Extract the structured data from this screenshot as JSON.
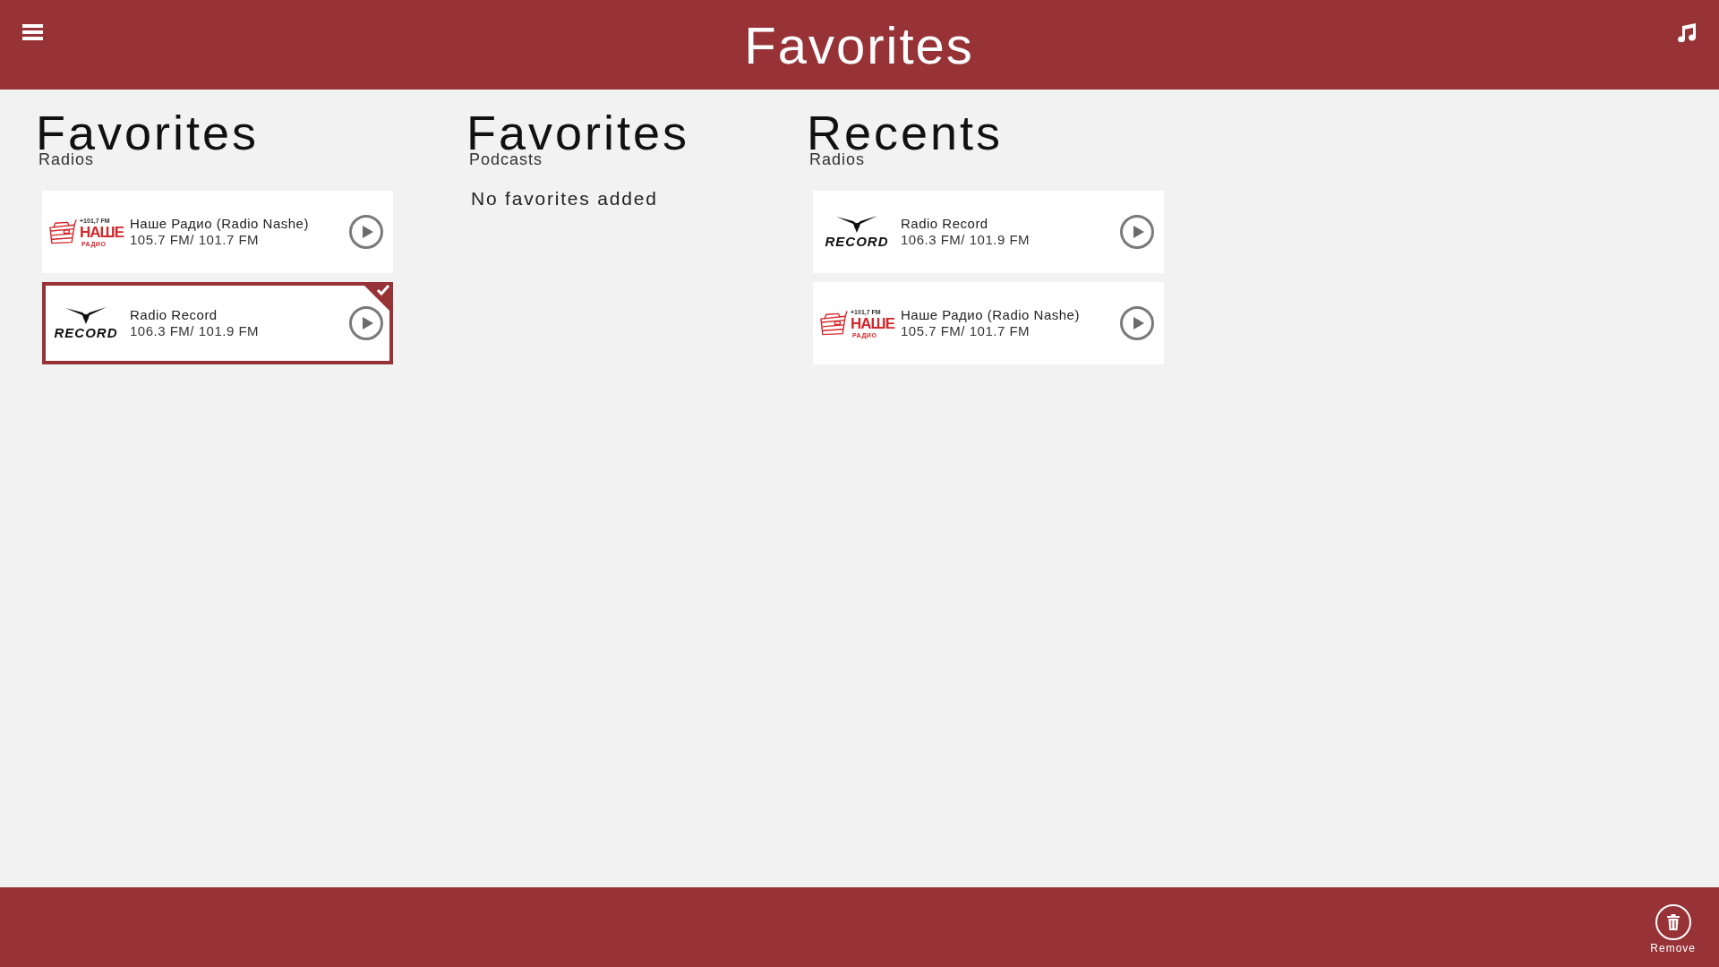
{
  "header": {
    "title": "Favorites"
  },
  "sections": [
    {
      "title": "Favorites",
      "subtitle": "Radios",
      "stations": [
        {
          "logo": {
            "kind": "nashe",
            "frequency": "+101,7 FM",
            "name": "НАШЕ",
            "tagline": "РАДИО"
          },
          "name": "Наше Радио (Radio Nashe)",
          "frequency": "105.7 FM/ 101.7 FM",
          "selected": false
        },
        {
          "logo": {
            "kind": "record",
            "name": "RECORD"
          },
          "name": "Radio Record",
          "frequency": "106.3 FM/ 101.9 FM",
          "selected": true
        }
      ]
    },
    {
      "title": "Favorites",
      "subtitle": "Podcasts",
      "empty_message": "No favorites added"
    },
    {
      "title": "Recents",
      "subtitle": "Radios",
      "stations": [
        {
          "logo": {
            "kind": "record",
            "name": "RECORD"
          },
          "name": "Radio Record",
          "frequency": "106.3 FM/ 101.9 FM",
          "selected": false
        },
        {
          "logo": {
            "kind": "nashe",
            "frequency": "+101,7 FM",
            "name": "НАШЕ",
            "tagline": "РАДИО"
          },
          "name": "Наше Радио (Radio Nashe)",
          "frequency": "105.7 FM/ 101.7 FM",
          "selected": false
        }
      ]
    }
  ],
  "app_bar": {
    "buttons": [
      {
        "label": "Remove"
      }
    ]
  }
}
